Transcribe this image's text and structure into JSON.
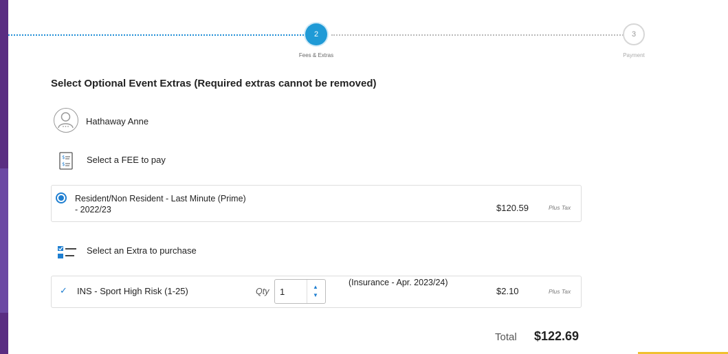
{
  "progress": {
    "steps": [
      {
        "number": "2",
        "label": "Fees & Extras",
        "state": "active"
      },
      {
        "number": "3",
        "label": "Payment",
        "state": "pending"
      }
    ]
  },
  "page_title": "Select Optional Event Extras (Required extras cannot be removed)",
  "participant": {
    "name": "Hathaway Anne",
    "icon": "user-avatar-icon"
  },
  "fee_section": {
    "label": "Select a FEE to pay",
    "icon": "fee-receipt-icon",
    "option": {
      "name": "Resident/Non Resident - Last Minute (Prime)",
      "season": "- 2022/23",
      "price": "$120.59",
      "tax_note": "Plus Tax",
      "selected": true
    }
  },
  "extra_section": {
    "label": "Select an Extra to purchase",
    "icon": "checklist-icon",
    "item": {
      "check": "✓",
      "name": "INS - Sport High Risk (1-25)",
      "qty_label": "Qty",
      "qty_value": "1",
      "description": "(Insurance - Apr. 2023/24)",
      "price": "$2.10",
      "tax_note": "Plus Tax"
    }
  },
  "total": {
    "label": "Total",
    "value": "$122.69"
  },
  "colors": {
    "accent": "#1f9ad6",
    "sidebar": "#5a2d82",
    "highlight": "#f0c030"
  }
}
